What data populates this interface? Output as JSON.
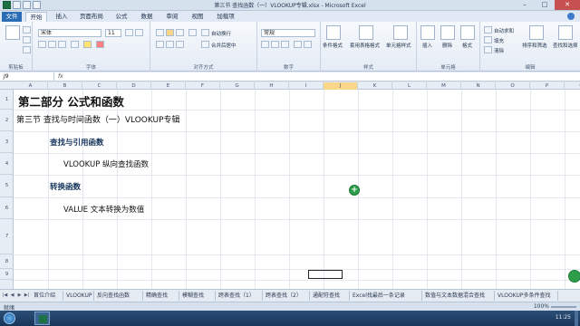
{
  "window": {
    "title": "第三节 查找函数（一）VLOOKUP专辑.xlsx - Microsoft Excel"
  },
  "ribbon_tabs": [
    "文件",
    "开始",
    "插入",
    "页面布局",
    "公式",
    "数据",
    "审阅",
    "视图",
    "加载项"
  ],
  "ribbon": {
    "font_name": "宋体",
    "font_size": "11",
    "wrap_text": "自动换行",
    "merge_center": "合并后居中",
    "number_format": "常规",
    "conditional_format": "条件格式",
    "format_as_table": "套用表格格式",
    "cell_styles": "单元格样式",
    "insert": "插入",
    "delete": "删除",
    "format": "格式",
    "autosum": "自动求和",
    "fill": "填充",
    "clear": "清除",
    "sort_filter": "排序和筛选",
    "find_select": "查找和选择",
    "groups": {
      "clipboard": "剪贴板",
      "font": "字体",
      "alignment": "对齐方式",
      "number": "数字",
      "styles": "样式",
      "cells": "单元格",
      "editing": "编辑"
    }
  },
  "formula_bar": {
    "name_box": "J9",
    "fx": "fx",
    "value": ""
  },
  "sheet": {
    "columns": [
      "A",
      "B",
      "C",
      "D",
      "E",
      "F",
      "G",
      "H",
      "I",
      "J",
      "K",
      "L",
      "M",
      "N",
      "O",
      "P",
      "Q"
    ],
    "selected_column": "J",
    "rows": [
      "1",
      "2",
      "3",
      "4",
      "5",
      "6",
      "7",
      "8",
      "9"
    ],
    "cells": {
      "title": "第二部分 公式和函数",
      "subtitle": "第三节 查找与时间函数（一）VLOOKUP专辑",
      "section1": "查找与引用函数",
      "item1": "VLOOKUP 纵向查找函数",
      "section2": "转换函数",
      "item2": "VALUE 文本转换为数值"
    }
  },
  "sheet_tabs": [
    "首位介绍",
    "VLOOKUP",
    "反向查找函数",
    "精确查找",
    "模糊查找",
    "跨表查找（1）",
    "跨表查找（2）",
    "通配符查找",
    "Excel找最后一条记录",
    "数值与文本数据混合查找",
    "VLOOKUP多条件查找"
  ],
  "status_bar": {
    "ready": "就绪",
    "zoom": "100%"
  },
  "taskbar": {
    "time": "11:25"
  }
}
